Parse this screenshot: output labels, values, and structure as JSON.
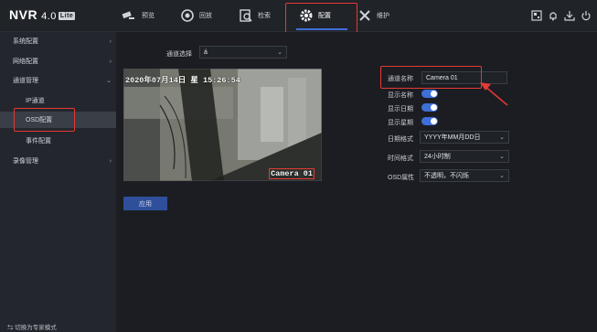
{
  "app": {
    "logo": "NVR",
    "version": "4.0",
    "edition": "Lite"
  },
  "nav": {
    "tabs": [
      {
        "label": "预览",
        "icon": "camera-icon"
      },
      {
        "label": "回放",
        "icon": "playback-icon"
      },
      {
        "label": "检索",
        "icon": "search-icon"
      },
      {
        "label": "配置",
        "icon": "gear-icon",
        "active": true
      },
      {
        "label": "维护",
        "icon": "tools-icon"
      }
    ],
    "right_icons": [
      "qr-code-icon",
      "bell-icon",
      "download-icon",
      "power-icon"
    ]
  },
  "sidebar": {
    "items": [
      {
        "label": "系统配置",
        "chevron": "›"
      },
      {
        "label": "网络配置",
        "chevron": "›"
      },
      {
        "label": "通道管理",
        "chevron": "⌄"
      },
      {
        "label": "IP通道",
        "sub": true
      },
      {
        "label": "OSD配置",
        "sub": true,
        "selected": true
      },
      {
        "label": "事件配置",
        "sub": true
      },
      {
        "label": "录像管理",
        "chevron": "›"
      }
    ],
    "bottom": "⇆ 切换为专家模式"
  },
  "main": {
    "channel_select_label": "通道选择",
    "channel_select_value": "á",
    "preview": {
      "osd_date_text": "2020年07月14日 星   15:26:54",
      "osd_camera_text": "Camera 01"
    },
    "form": {
      "channel_name_label": "通道名称",
      "channel_name_value": "Camera 01",
      "show_name_label": "显示名称",
      "show_date_label": "显示日期",
      "show_week_label": "显示星期",
      "date_format_label": "日期格式",
      "date_format_value": "YYYY年MM月DD日",
      "time_format_label": "时间格式",
      "time_format_value": "24小时制",
      "osd_attr_label": "OSD属性",
      "osd_attr_value": "不透明，不闪烁"
    },
    "apply_label": "应用"
  },
  "colors": {
    "accent": "#3f6fd8",
    "highlight": "#e53935",
    "background": "#1b1d22"
  }
}
